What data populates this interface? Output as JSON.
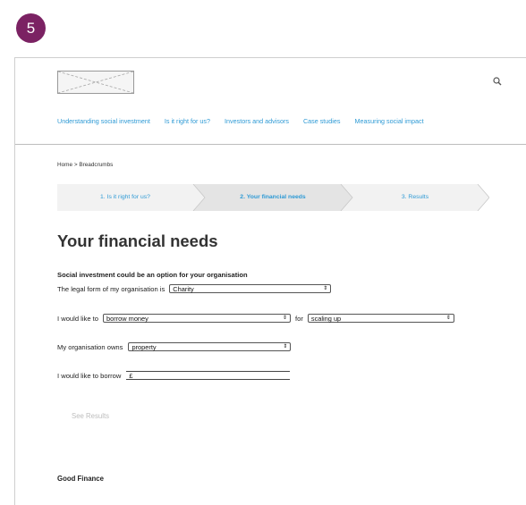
{
  "step_number": "5",
  "header": {
    "logo_icon": "logo-placeholder-icon",
    "search_icon": "search-icon"
  },
  "nav": {
    "items": [
      {
        "label": "Understanding social investment"
      },
      {
        "label": "Is it right for us?"
      },
      {
        "label": "Investors and advisors"
      },
      {
        "label": "Case studies"
      },
      {
        "label": "Measuring social impact"
      }
    ]
  },
  "breadcrumb": "Home > Breadcrumbs",
  "steps": [
    {
      "label": "1. Is it right for us?",
      "state": "complete"
    },
    {
      "label": "2. Your financial needs",
      "state": "current"
    },
    {
      "label": "3. Results",
      "state": "upcoming"
    }
  ],
  "page_title": "Your financial needs",
  "form": {
    "subheading": "Social investment could be an option for your organisation",
    "legal_form_label": "The legal form of my organisation is",
    "legal_form_value": "Charity",
    "like_to_label": "I would like to",
    "like_to_value": "borrow money",
    "for_label": "for",
    "for_value": "scaling up",
    "owns_label": "My organisation owns",
    "owns_value": "property",
    "borrow_label": "I would like to borrow",
    "borrow_value": "£",
    "see_results_label": "See Results"
  },
  "footer": {
    "title": "Good Finance"
  },
  "colors": {
    "accent": "#2e9ad5",
    "badge": "#7b2263",
    "step_bg": "#f2f2f2",
    "step_current_bg": "#e4e4e4"
  }
}
